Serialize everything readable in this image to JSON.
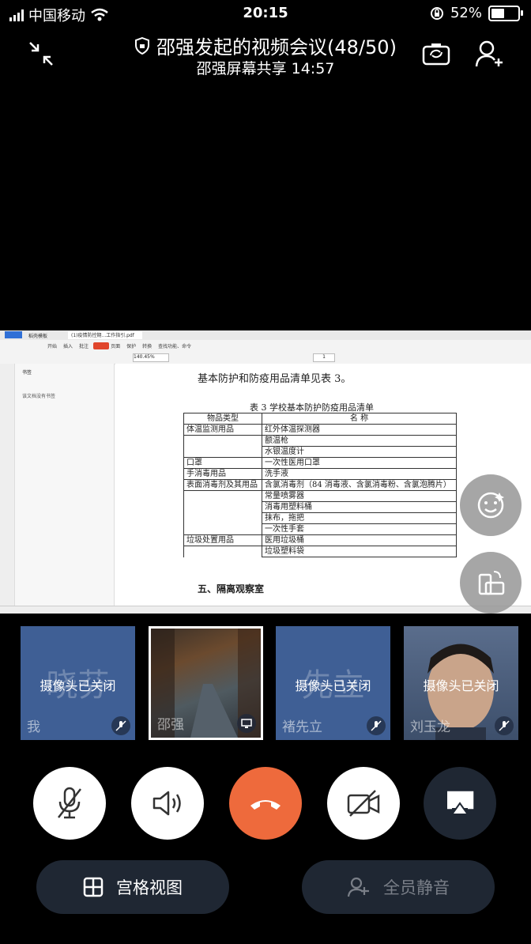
{
  "status": {
    "carrier": "中国移动",
    "time": "20:15",
    "battery": "52%",
    "battery_level": 0.52
  },
  "header": {
    "title": "邵强发起的视频会议(48/50)",
    "subtitle": "邵强屏幕共享  14:57"
  },
  "shared_doc": {
    "tab1": "稻壳模板",
    "tab2": "(1)疫情防控期...工作指引.pdf",
    "toolbar_items": [
      "开始",
      "插入",
      "批注",
      "编辑",
      "页面",
      "保护",
      "转换",
      "查找功能、命令"
    ],
    "zoom": "140.45%",
    "page": "1",
    "sidebar_title": "书签",
    "sidebar_item": "该文档没有书签",
    "intro": "基本防护和防疫用品清单见表 3。",
    "table_title": "表 3   学校基本防护防疫用品清单",
    "table_header": [
      "物品类型",
      "名   称"
    ],
    "table_rows": [
      [
        "体温监测用品",
        "红外体温探测器"
      ],
      [
        "",
        "额温枪"
      ],
      [
        "",
        "水银温度计"
      ],
      [
        "口罩",
        "一次性医用口罩"
      ],
      [
        "手消毒用品",
        "洗手液"
      ],
      [
        "表面消毒剂及其用品",
        "含氯消毒剂（84 消毒液、含氯消毒粉、含氯泡腾片）"
      ],
      [
        "",
        "常量喷雾器"
      ],
      [
        "",
        "消毒用塑料桶"
      ],
      [
        "",
        "抹布，拖把"
      ],
      [
        "",
        "一次性手套"
      ],
      [
        "垃圾处置用品",
        "医用垃圾桶"
      ],
      [
        "",
        "垃圾塑料袋"
      ]
    ],
    "section": "五、隔离观察室"
  },
  "tiles": [
    {
      "ghost": "晓芬",
      "camera": "摄像头已关闭",
      "name": "我",
      "muted": true
    },
    {
      "ghost": "",
      "camera": "",
      "name": "邵强",
      "muted": false
    },
    {
      "ghost": "先立",
      "camera": "摄像头已关闭",
      "name": "褚先立",
      "muted": true
    },
    {
      "ghost": "",
      "camera": "摄像头已关闭",
      "name": "刘玉龙",
      "muted": true
    }
  ],
  "controls": {
    "grid_view": "宫格视图",
    "mute_all": "全员静音"
  },
  "colors": {
    "tile_bg": "#3f5f95",
    "hangup": "#ee6a3c",
    "pill_bg": "#1f2733"
  }
}
